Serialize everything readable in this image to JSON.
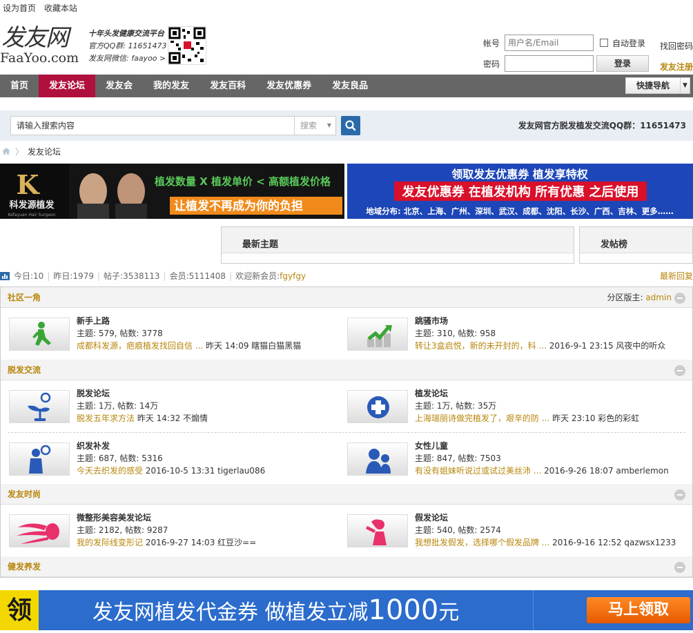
{
  "topbar": {
    "set_home": "设为首页",
    "bookmark": "收藏本站"
  },
  "header": {
    "logo_cn": "发友网",
    "logo_en": "FaaYoo.com",
    "slogan1": "十年头发健康交流平台",
    "slogan2": "官方QQ群: 11651473",
    "slogan3": "发友网微信: faayoo  >"
  },
  "login": {
    "account_label": "帐号",
    "account_placeholder": "用户名/Email",
    "password_label": "密码",
    "auto_login": "自动登录",
    "login_button": "登录",
    "find_password": "找回密码",
    "register": "发友注册"
  },
  "nav": {
    "items": [
      "首页",
      "发友论坛",
      "发友会",
      "我的发友",
      "发友百科",
      "发友优惠券",
      "发友良品"
    ],
    "quick_nav": "快捷导航"
  },
  "search": {
    "placeholder": "请输入搜索内容",
    "type": "搜索",
    "qq_group": "发友网官方脱发植发交流QQ群：11651473"
  },
  "breadcrumb": {
    "current": "发友论坛"
  },
  "banners": {
    "b1_logo": "科发源植发",
    "b1_sub": "Kefayuan Hair Surgeon",
    "b1_line1": "植发数量 X 植发单价 < 高额植发价格",
    "b1_line2": "让植发不再成为你的负担",
    "b2_line1": "领取发友优惠券  植发享特权",
    "b2_line2": "发友优惠券 在植发机构 所有优惠 之后使用",
    "b2_line3": "地域分布: 北京、上海、广州、深圳、武汉、成都、沈阳、长沙、广西、吉林、更多……"
  },
  "tabs": {
    "latest": "最新主题",
    "top_posters": "发帖榜"
  },
  "stats": {
    "today_label": "今日: ",
    "today": "10",
    "yesterday_label": "昨日: ",
    "yesterday": "1979",
    "posts_label": "帖子: ",
    "posts": "3538113",
    "members_label": "会员: ",
    "members": "5111408",
    "welcome_label": "欢迎新会员: ",
    "newest": "fgyfgy",
    "latest_reply": "最新回复"
  },
  "sections": [
    {
      "title": "社区一角",
      "moderator_label": "分区版主: ",
      "moderator": "admin"
    },
    {
      "title": "脱发交流"
    },
    {
      "title": "发友时尚"
    },
    {
      "title": "健发养发"
    }
  ],
  "forums": {
    "newbie": {
      "title": "新手上路",
      "stats": "主题: 579, 帖数: 3778",
      "last_title": "成都科发源，疤痕植发找回自信 ...",
      "last_meta": " 昨天 14:09 瞎猫白猫黑猫"
    },
    "market": {
      "title": "跳骚市场",
      "stats": "主题: 310, 帖数: 958",
      "last_title": "转让3盒启悦，新的未开封的，科 ...",
      "last_meta": " 2016-9-1 23:15 风夜中的听众"
    },
    "hairloss": {
      "title": "脱发论坛",
      "stats": "主题: 1万, 帖数: 14万",
      "last_title": "脱发五年求方法",
      "last_meta": " 昨天 14:32 不煽情"
    },
    "transplant": {
      "title": "植发论坛",
      "stats": "主题: 1万, 帖数: 35万",
      "last_title": "上海瑞丽诗做完植发了，艰辛的防 ...",
      "last_meta": " 昨天 23:10 彩色的彩虹"
    },
    "weave": {
      "title": "织发补发",
      "stats": "主题: 687, 帖数: 5316",
      "last_title": "今天去织发的感受",
      "last_meta": " 2016-10-5 13:31 tigerlau086"
    },
    "women": {
      "title": "女性儿童",
      "stats": "主题: 847, 帖数: 7503",
      "last_title": "有没有姐妹听说过或试过美丝沛 ...",
      "last_meta": " 2016-9-26 18:07 amberlemon"
    },
    "beauty": {
      "title": "微整形美容美发论坛",
      "stats": "主题: 2182, 帖数: 9287",
      "last_title": "我的发际线变形记",
      "last_meta": " 2016-9-27 14:03 红豆沙=="
    },
    "wig": {
      "title": "假发论坛",
      "stats": "主题: 540, 帖数: 2574",
      "last_title": "我想批发假发，选择哪个假发品牌 ...",
      "last_meta": " 2016-9-16 12:52 qazwsx1233"
    }
  },
  "bottom_ad": {
    "ling": "领",
    "text": "发友网植发代金券  做植发立减",
    "amount": "1000",
    "unit": "元",
    "button": "马上领取"
  },
  "colors": {
    "nav_bg": "#666666",
    "nav_active": "#b0103c",
    "link_gold": "#b8860b",
    "icon_green": "#3aa537",
    "icon_blue": "#2a5ab8",
    "icon_pink": "#e8306a"
  }
}
